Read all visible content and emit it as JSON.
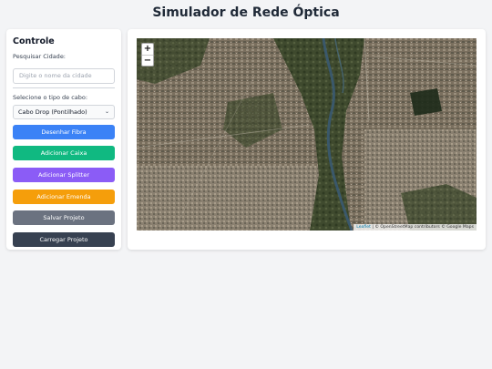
{
  "page": {
    "title": "Simulador de Rede Óptica"
  },
  "controls": {
    "heading": "Controle",
    "search_label": "Pesquisar Cidade:",
    "search_placeholder": "Digite o nome da cidade",
    "cable_label": "Selecione o tipo de cabo:",
    "cable_selected": "Cabo Drop (Pontilhado)",
    "buttons": [
      {
        "label": "Desenhar Fibra",
        "color": "#3b82f6"
      },
      {
        "label": "Adicionar Caixa",
        "color": "#10b981"
      },
      {
        "label": "Adicionar Splitter",
        "color": "#8b5cf6"
      },
      {
        "label": "Adicionar Emenda",
        "color": "#f59e0b"
      },
      {
        "label": "Salvar Projeto",
        "color": "#6b7280"
      },
      {
        "label": "Carregar Projeto",
        "color": "#374151"
      }
    ]
  },
  "map": {
    "zoom_in": "+",
    "zoom_out": "−",
    "attribution_leaflet": "Leaflet",
    "attribution_rest": " | © OpenStreetMap contributors © Google Maps"
  }
}
